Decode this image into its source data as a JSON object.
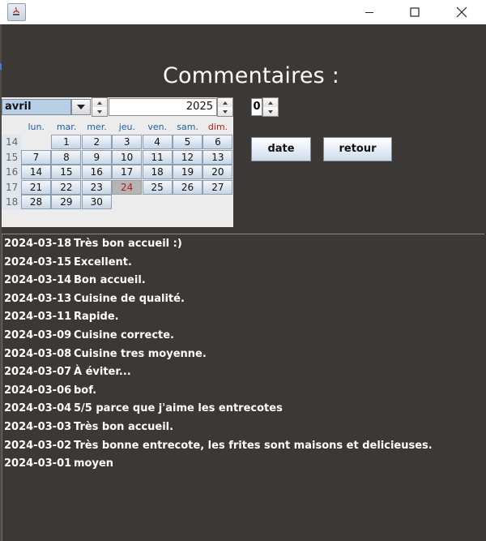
{
  "window": {
    "minimize_glyph": "—",
    "maximize_glyph": "☐",
    "close_glyph": "✕"
  },
  "title": "Commentaires :",
  "calendar": {
    "month": "avril",
    "year": "2025",
    "day_headers": [
      "lun.",
      "mar.",
      "mer.",
      "jeu.",
      "ven.",
      "sam.",
      "dim."
    ],
    "weeks": [
      "14",
      "15",
      "16",
      "17",
      "18"
    ],
    "days": [
      "1",
      "2",
      "3",
      "4",
      "5",
      "6",
      "7",
      "8",
      "9",
      "10",
      "11",
      "12",
      "13",
      "14",
      "15",
      "16",
      "17",
      "18",
      "19",
      "20",
      "21",
      "22",
      "23",
      "24",
      "25",
      "26",
      "27",
      "28",
      "29",
      "30"
    ],
    "today": "24",
    "colors": {
      "sunday": "#b02020",
      "weekday": "#2060a8"
    }
  },
  "spinner_value": "0",
  "buttons": {
    "date": "date",
    "retour": "retour"
  },
  "comments": [
    {
      "date": "2024-03-18",
      "text": "Très bon accueil :)"
    },
    {
      "date": "2024-03-15",
      "text": "Excellent."
    },
    {
      "date": "2024-03-14",
      "text": "Bon accueil."
    },
    {
      "date": "2024-03-13",
      "text": "Cuisine de qualité."
    },
    {
      "date": "2024-03-11",
      "text": "Rapide."
    },
    {
      "date": "2024-03-09",
      "text": "Cuisine correcte."
    },
    {
      "date": "2024-03-08",
      "text": "Cuisine tres moyenne."
    },
    {
      "date": "2024-03-07",
      "text": "À éviter..."
    },
    {
      "date": "2024-03-06",
      "text": "bof."
    },
    {
      "date": "2024-03-04",
      "text": "5/5 parce que j'aime les entrecotes"
    },
    {
      "date": "2024-03-03",
      "text": "Très bon accueil."
    },
    {
      "date": "2024-03-02",
      "text": "Très bonne entrecote, les frites sont maisons et delicieuses."
    },
    {
      "date": "2024-03-01",
      "text": "moyen"
    }
  ]
}
